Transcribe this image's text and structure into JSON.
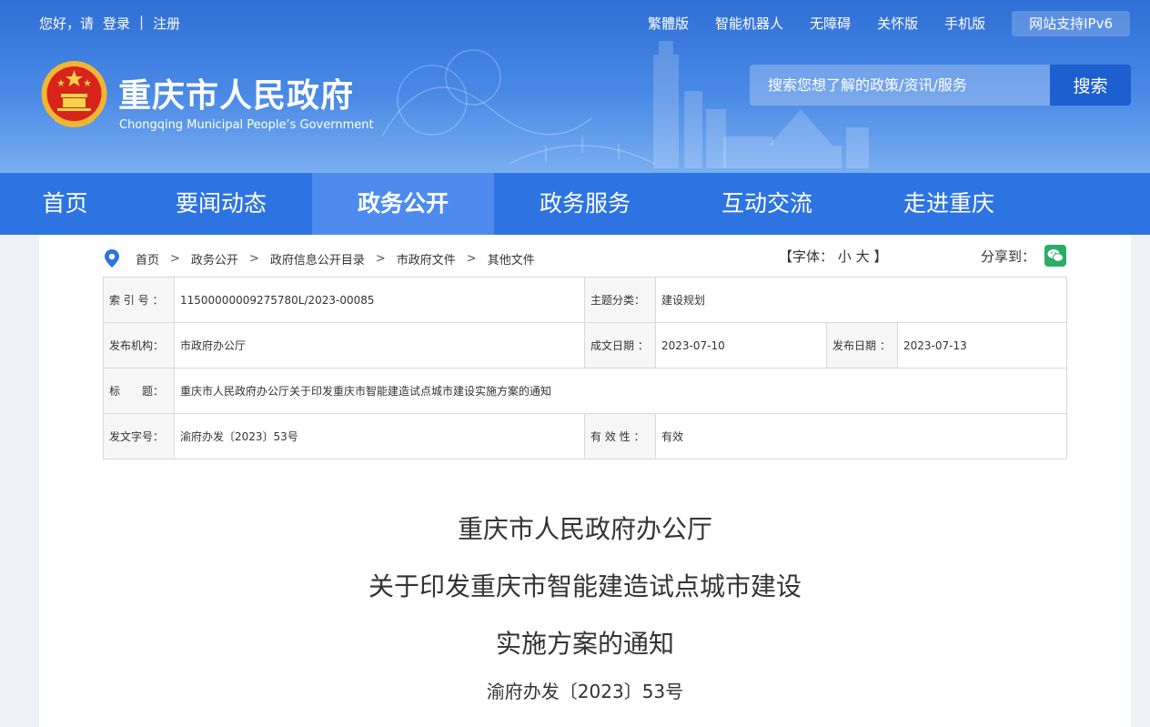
{
  "topbar": {
    "greeting": "您好，请",
    "login": "登录",
    "separator": "|",
    "register": "注册",
    "links": [
      "繁體版",
      "智能机器人",
      "无障碍",
      "关怀版",
      "手机版"
    ],
    "ipv6": "网站支持IPv6"
  },
  "brand": {
    "title": "重庆市人民政府",
    "subtitle": "Chongqing Municipal People’s Government",
    "emblem_icon": "national-emblem-icon"
  },
  "search": {
    "placeholder": "搜索您想了解的政策/资讯/服务",
    "button": "搜索"
  },
  "nav": {
    "items": [
      "首页",
      "要闻动态",
      "政务公开",
      "政务服务",
      "互动交流",
      "走进重庆"
    ],
    "active": "政务公开"
  },
  "breadcrumb": {
    "items": [
      "首页",
      "政务公开",
      "政府信息公开目录",
      "市政府文件",
      "其他文件"
    ],
    "arrow": ">"
  },
  "font_size": {
    "prefix": "【字体：",
    "small": "小",
    "large": "大",
    "suffix": "】"
  },
  "share": {
    "label": "分享到：",
    "icon": "wechat-icon"
  },
  "meta": {
    "index_label": "索 引 号 ：",
    "index_value": "11500000009275780L/2023-00085",
    "topic_label": "主题分类：",
    "topic_value": "建设规划",
    "org_label": "发布机构：",
    "org_value": "市政府办公厅",
    "created_label": "成文日期 ：",
    "created_value": "2023-07-10",
    "published_label": "发布日期 ：",
    "published_value": "2023-07-13",
    "title_label": "标　　题：",
    "title_value": "重庆市人民政府办公厅关于印发重庆市智能建造试点城市建设实施方案的通知",
    "docno_label": "发文字号：",
    "docno_value": "渝府办发〔2023〕53号",
    "validity_label": "有 效 性 ：",
    "validity_value": "有效"
  },
  "document": {
    "title_line1": "重庆市人民政府办公厅",
    "title_line2": "关于印发重庆市智能建造试点城市建设",
    "title_line3": "实施方案的通知",
    "number": "渝府办发〔2023〕53号"
  },
  "colors": {
    "header_blue": "#2f6fd6",
    "nav_blue": "#2d74e2",
    "nav_active": "#4d8bee",
    "search_button": "#1d5fce",
    "pin_blue": "#2d74e2",
    "wechat_green": "#2aae67"
  }
}
